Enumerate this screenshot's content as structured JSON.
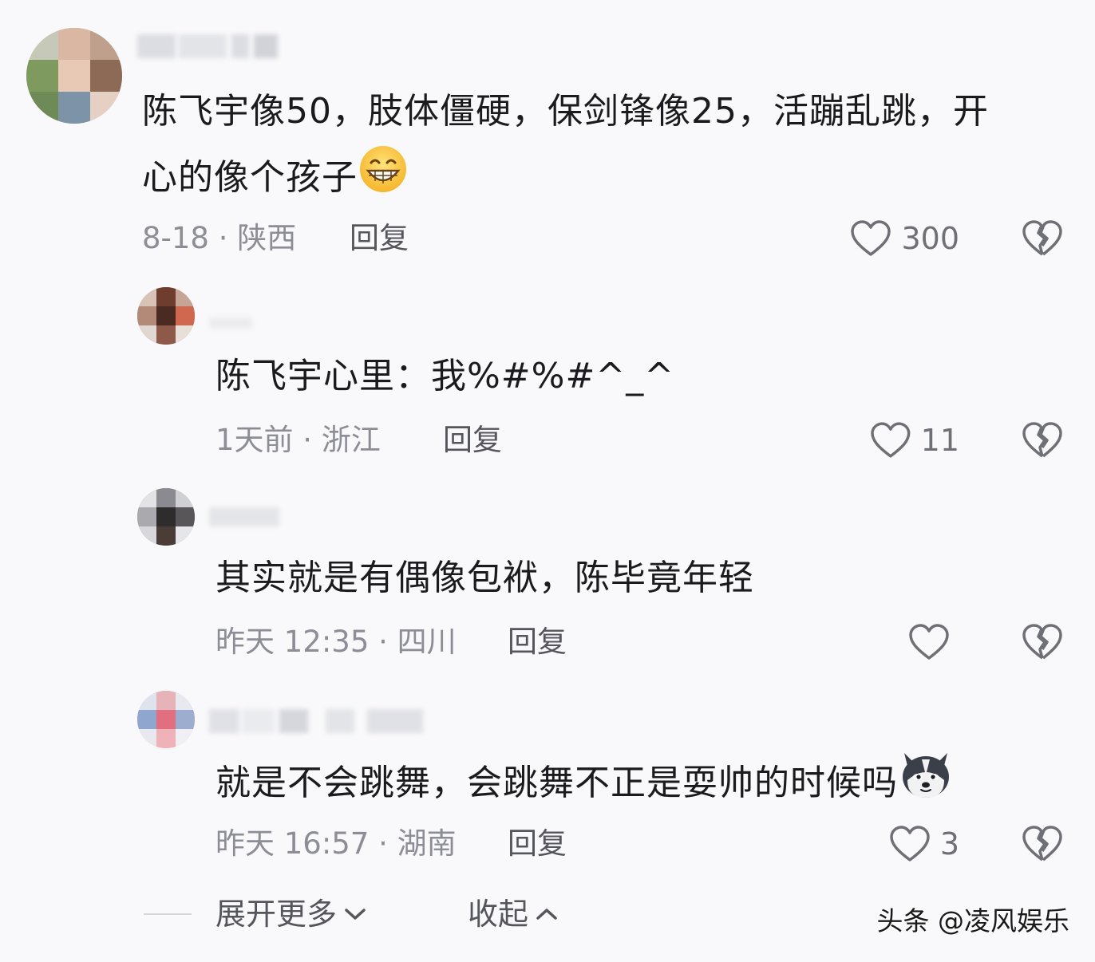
{
  "comments": [
    {
      "text_line1": "陈飞宇像50，肢体僵硬，保剑锋像25，活蹦乱跳，开",
      "text_line2": "心的像个孩子",
      "emoji": "grinning-face-icon",
      "meta": "8-18 · 陕西",
      "reply_label": "回复",
      "likes": "300"
    },
    {
      "text": "陈飞宇心里：我%#%#^_^",
      "meta": "1天前 · 浙江",
      "reply_label": "回复",
      "likes": "11"
    },
    {
      "text": "其实就是有偶像包袱，陈毕竟年轻",
      "meta": "昨天 12:35 · 四川",
      "reply_label": "回复",
      "likes": ""
    },
    {
      "text": "就是不会跳舞，会跳舞不正是耍帅的时候吗",
      "emoji": "husky-dog-icon",
      "meta": "昨天 16:57 · 湖南",
      "reply_label": "回复",
      "likes": "3"
    }
  ],
  "footer": {
    "expand_label": "展开更多",
    "collapse_label": "收起"
  },
  "watermark": "头条 @凌风娱乐",
  "colors": {
    "background": "#f9f9fb",
    "text": "#1b1b1f",
    "meta": "#8d8d95",
    "icon": "#6f6f76"
  }
}
